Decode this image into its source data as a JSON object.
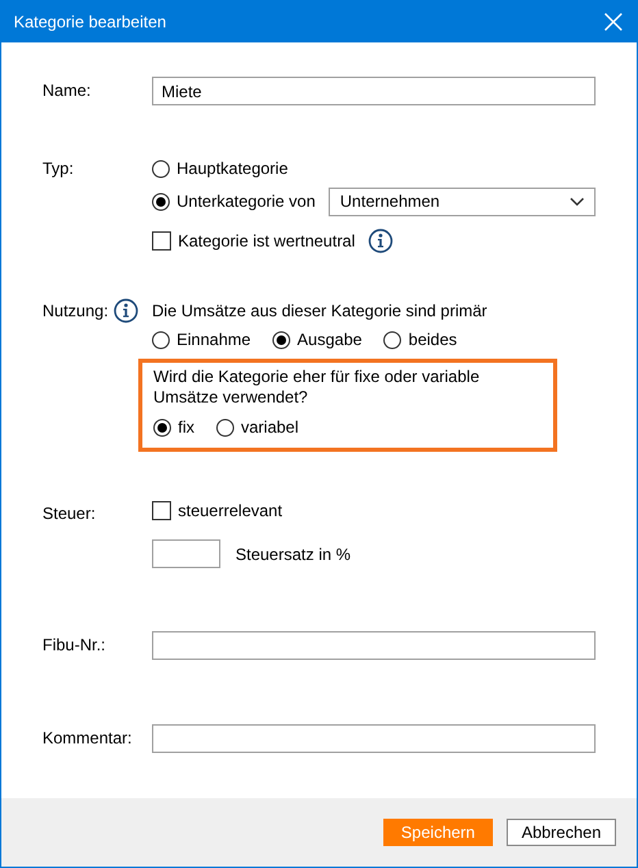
{
  "window": {
    "title": "Kategorie bearbeiten"
  },
  "name": {
    "label": "Name:",
    "value": "Miete"
  },
  "type": {
    "label": "Typ:",
    "options": [
      {
        "label": "Hauptkategorie",
        "selected": false,
        "kind": "plain"
      },
      {
        "label": "Unterkategorie von",
        "selected": true,
        "kind": "dropdown",
        "dropdown_value": "Unternehmen"
      }
    ],
    "neutral": {
      "label": "Kategorie ist wertneutral",
      "checked": false
    }
  },
  "usage": {
    "label": "Nutzung:",
    "intro": "Die Umsätze aus dieser Kategorie sind primär",
    "options": [
      {
        "label": "Einnahme",
        "selected": false
      },
      {
        "label": "Ausgabe",
        "selected": true
      },
      {
        "label": "beides",
        "selected": false
      }
    ],
    "highlight": {
      "question": "Wird die Kategorie eher für fixe oder variable Umsätze verwendet?",
      "options": [
        {
          "label": "fix",
          "selected": true
        },
        {
          "label": "variabel",
          "selected": false
        }
      ]
    }
  },
  "tax": {
    "label": "Steuer:",
    "checkbox": {
      "label": "steuerrelevant",
      "checked": false
    },
    "rate_label": "Steuersatz in %"
  },
  "fibu": {
    "label": "Fibu-Nr.:"
  },
  "comment": {
    "label": "Kommentar:"
  },
  "buttons": [
    {
      "label": "Speichern",
      "kind": "primary"
    },
    {
      "label": "Abbrechen",
      "kind": "secondary"
    }
  ]
}
